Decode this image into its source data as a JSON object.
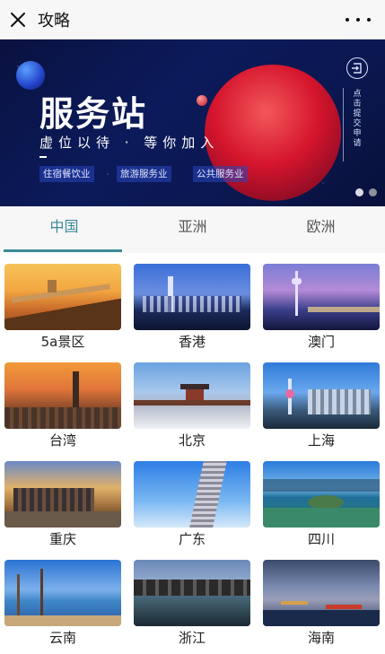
{
  "header": {
    "title": "攻略",
    "close_icon": "close-icon",
    "more_icon": "more-dots-icon"
  },
  "banner": {
    "title": "服务站",
    "subtitle": "虚位以待 · 等你加入",
    "tags": [
      "住宿餐饮业",
      "旅游服务业",
      "公共服务业"
    ],
    "side_text": "点击提交申请",
    "side_icon": "enter-icon",
    "colors": {
      "accent_red": "#e0152b",
      "background": "#0b1a5a"
    },
    "carousel": {
      "count": 2,
      "active_index": 0
    }
  },
  "tabs": [
    {
      "label": "中国",
      "active": true
    },
    {
      "label": "亚洲",
      "active": false
    },
    {
      "label": "欧洲",
      "active": false
    }
  ],
  "destinations": [
    {
      "label": "5a景区"
    },
    {
      "label": "香港"
    },
    {
      "label": "澳门"
    },
    {
      "label": "台湾"
    },
    {
      "label": "北京"
    },
    {
      "label": "上海"
    },
    {
      "label": "重庆"
    },
    {
      "label": "广东"
    },
    {
      "label": "四川"
    },
    {
      "label": "云南"
    },
    {
      "label": "浙江"
    },
    {
      "label": "海南"
    }
  ],
  "theme": {
    "accent": "#3a8a97"
  }
}
